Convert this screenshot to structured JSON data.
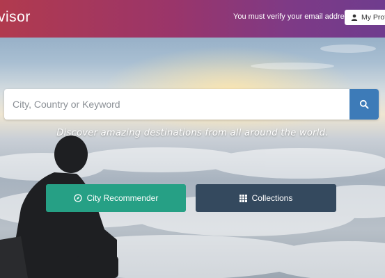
{
  "navbar": {
    "brand": "visor",
    "verify_message": "You must verify your email address",
    "profile_label": "My Profi"
  },
  "search": {
    "value": "",
    "placeholder": "City, Country or Keyword"
  },
  "hero": {
    "tagline": "Discover amazing destinations from all around the world."
  },
  "actions": {
    "city_recommender": "City Recommender",
    "collections": "Collections"
  },
  "colors": {
    "nav_start": "#b13a4e",
    "nav_end": "#6f3c8e",
    "search_button": "#3d7bb8",
    "city_button": "#26a085",
    "collections_button": "#34495e"
  },
  "icons": {
    "profile": "user-icon",
    "search": "search-icon",
    "city": "compass-icon",
    "collections": "grid-icon"
  }
}
